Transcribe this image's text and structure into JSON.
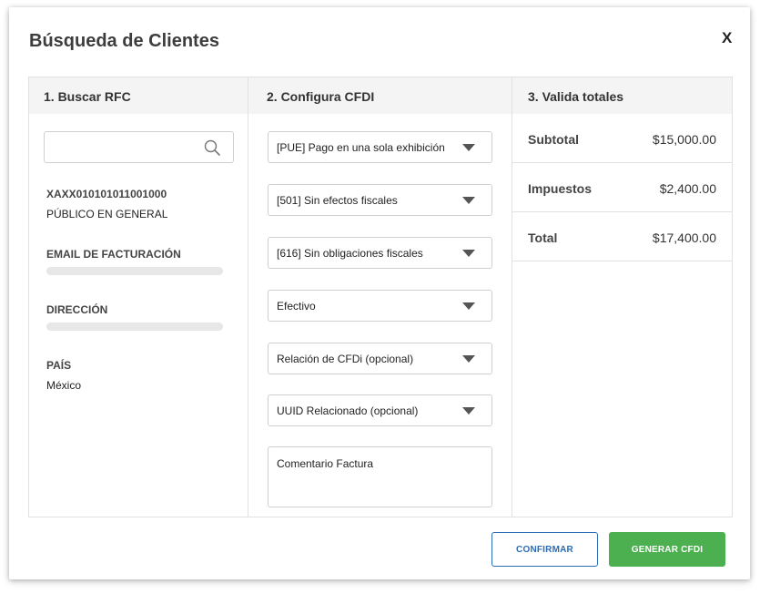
{
  "modal": {
    "title": "Búsqueda de Clientes",
    "close_label": "X"
  },
  "column1": {
    "header": "1. Buscar RFC",
    "search": {
      "value": "",
      "placeholder": ""
    },
    "rfc": "XAXX010101011001000",
    "name": "PÚBLICO EN GENERAL",
    "email_label": "EMAIL DE FACTURACIÓN",
    "address_label": "DIRECCIÓN",
    "country_label": "PAÍS",
    "country_value": "México"
  },
  "column2": {
    "header": "2. Configura CFDI",
    "selects": [
      "[PUE] Pago en una sola exhibición",
      "[501] Sin efectos fiscales",
      "[616] Sin obligaciones fiscales",
      "Efectivo",
      "Relación de CFDi (opcional)",
      "UUID Relacionado (opcional)"
    ],
    "comment_placeholder": "Comentario Factura"
  },
  "column3": {
    "header": "3. Valida totales",
    "rows": [
      {
        "label": "Subtotal",
        "value": "$15,000.00"
      },
      {
        "label": "Impuestos",
        "value": "$2,400.00"
      },
      {
        "label": "Total",
        "value": "$17,400.00"
      }
    ]
  },
  "actions": {
    "confirm_label": "CONFIRMAR",
    "generate_label": "GENERAR CFDI"
  },
  "colors": {
    "primary_blue": "#2b6cb5",
    "success_green": "#4caf50",
    "header_bg": "#f4f4f4",
    "border": "#e1e1e1"
  }
}
